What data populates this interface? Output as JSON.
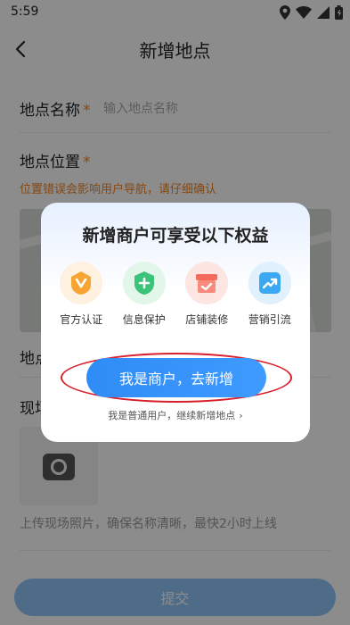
{
  "status_bar": {
    "time": "5:59"
  },
  "nav": {
    "title": "新增地点"
  },
  "form": {
    "name_label": "地点名称",
    "required_mark": "*",
    "name_placeholder": "输入地点名称",
    "location_label": "地点位置",
    "location_warning": "位置错误会影响用户导航，请仔细确认",
    "address_label_fragment": "地点",
    "photo_label_fragment": "现场",
    "photo_hint": "上传现场照片，确保名称清晰，最快2小时上线",
    "submit_label": "提交"
  },
  "modal": {
    "heading": "新增商户可享受以下权益",
    "benefits": [
      {
        "label": "官方认证",
        "icon": "verified-badge-icon",
        "color": "#f6a533"
      },
      {
        "label": "信息保护",
        "icon": "shield-plus-icon",
        "color": "#3cc37a"
      },
      {
        "label": "店铺装修",
        "icon": "store-icon",
        "color": "#f56b5b"
      },
      {
        "label": "营销引流",
        "icon": "trend-up-icon",
        "color": "#3aa8f2"
      }
    ],
    "primary_button": "我是商户，去新增",
    "secondary_link": "我是普通用户，继续新增地点",
    "highlight_color": "#d81e2a"
  }
}
